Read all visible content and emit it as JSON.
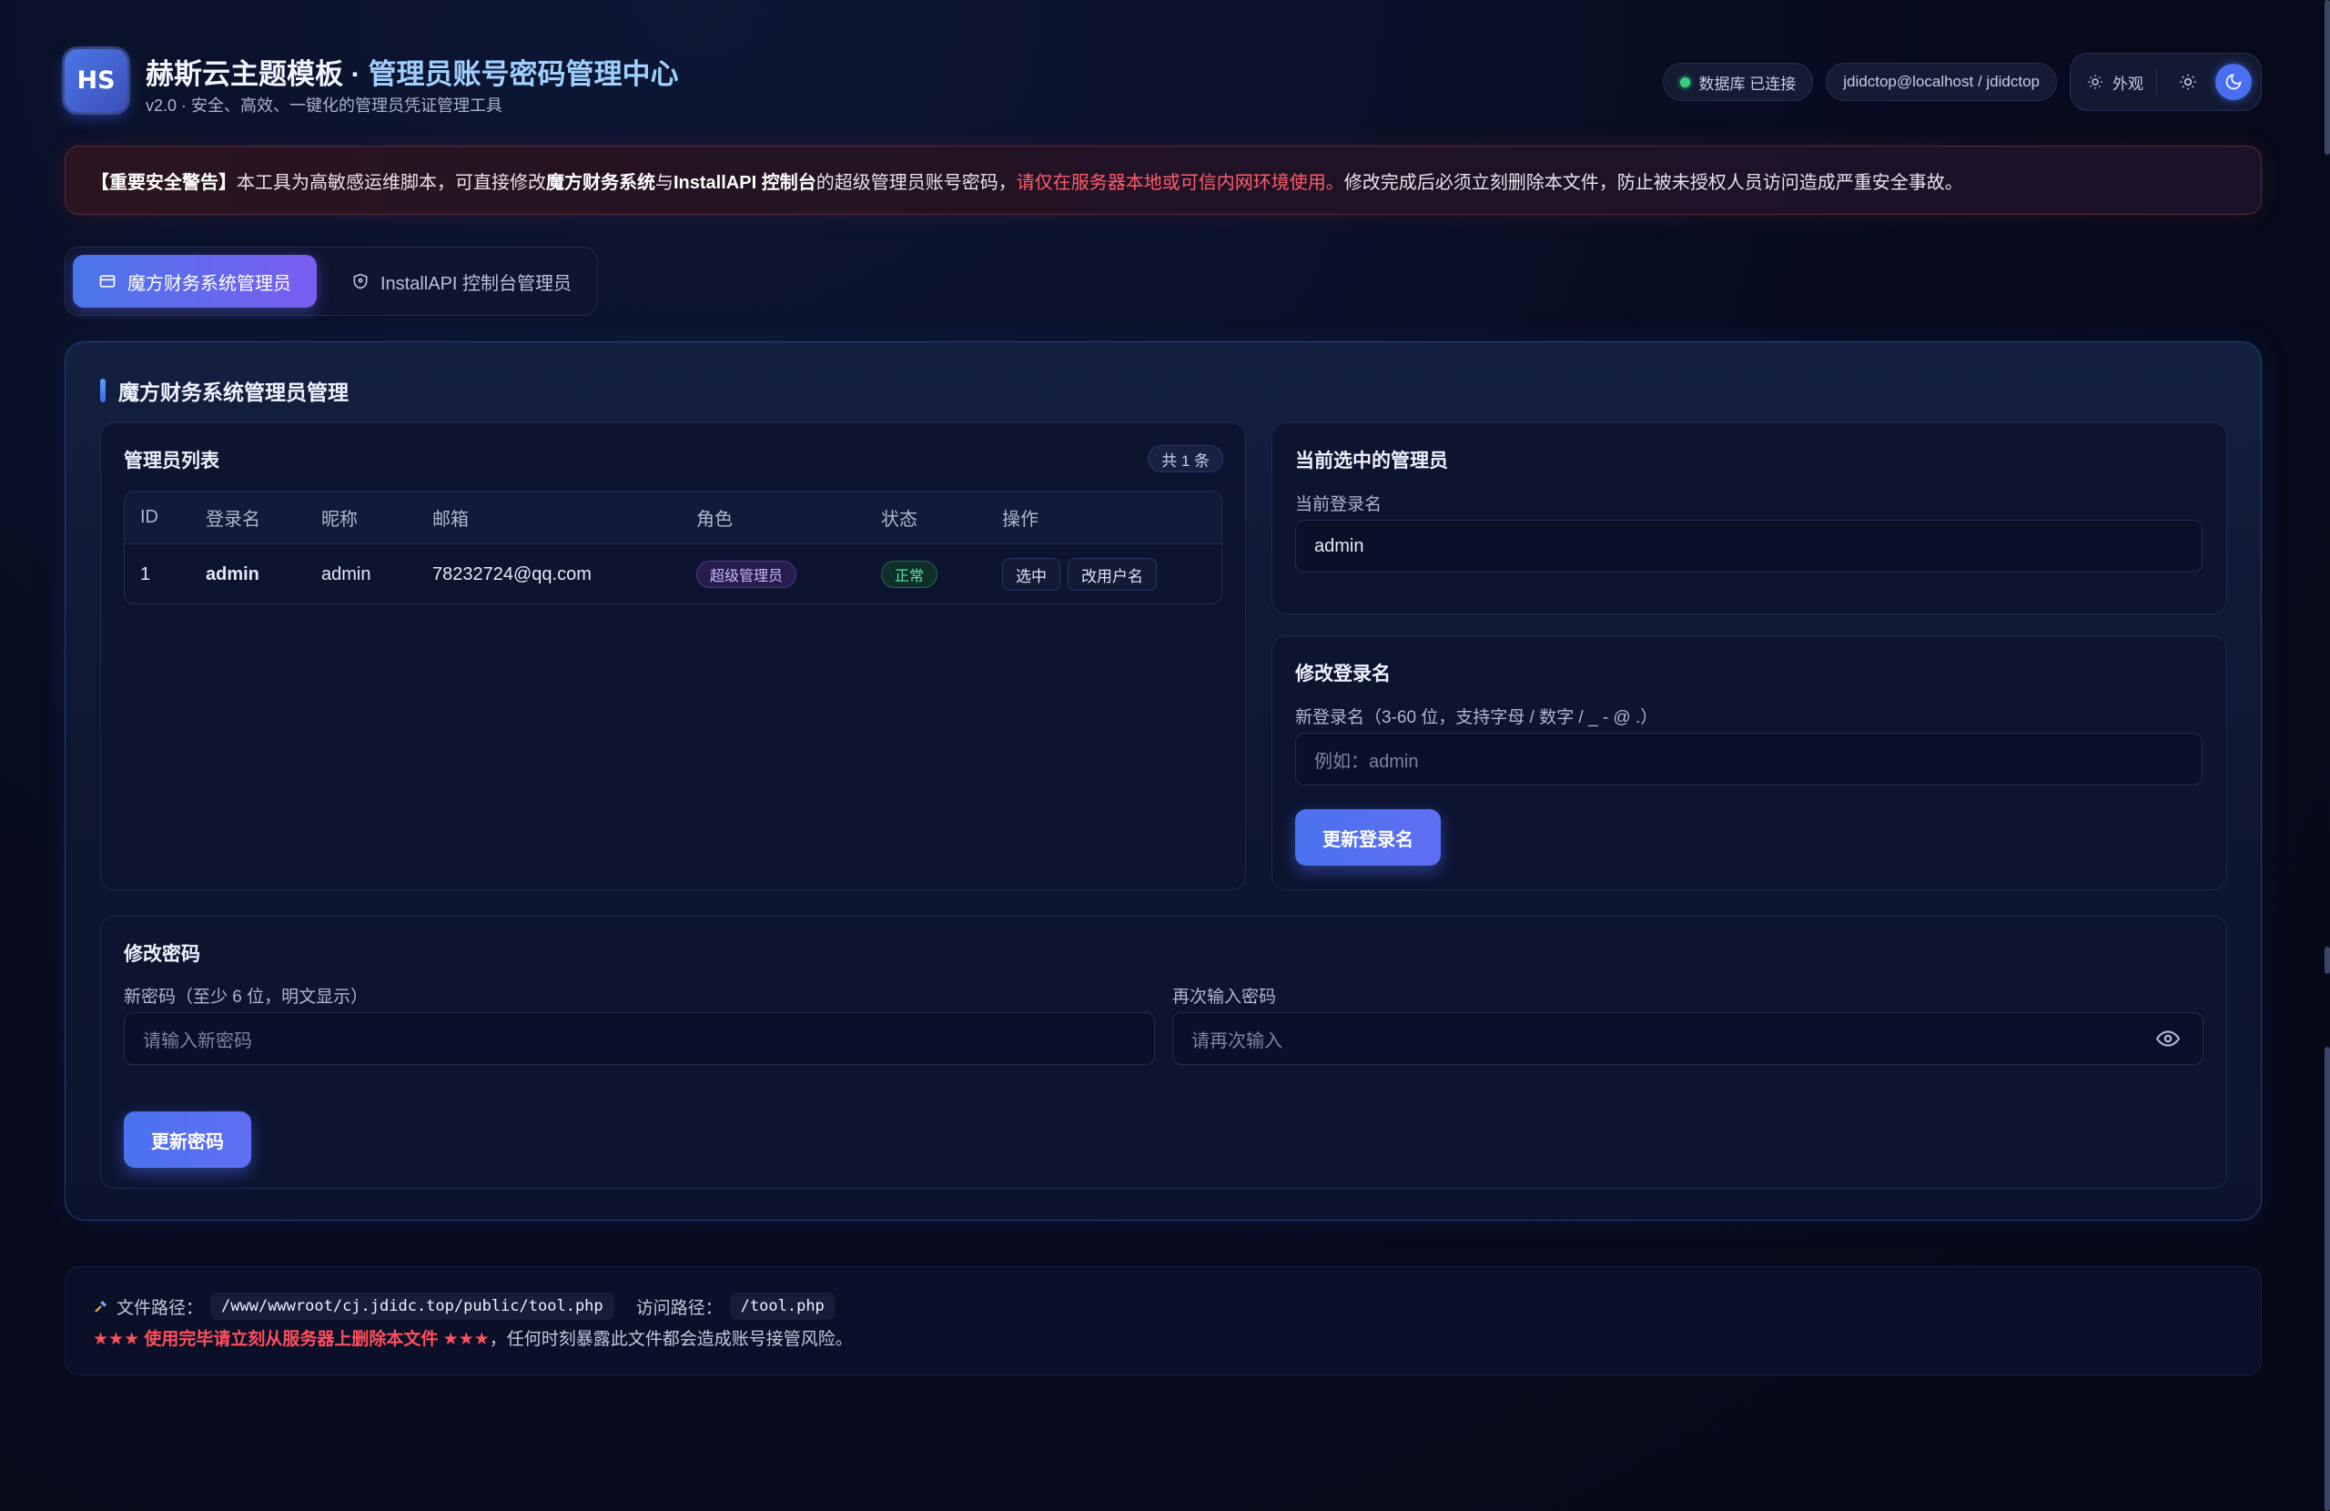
{
  "header": {
    "logo_text": "HS",
    "title_main": "赫斯云主题模板 · ",
    "title_accent": "管理员账号密码管理中心",
    "subtitle": "v2.0 · 安全、高效、一键化的管理员凭证管理工具",
    "db_status": "数据库 已连接",
    "db_user": "jdidctop@localhost / jdidctop",
    "appearance_label": "外观"
  },
  "warning": {
    "prefix": "【重要安全警告】",
    "text1": "本工具为高敏感运维脚本，可直接修改 ",
    "sys1": "魔方财务系统",
    "text2": " 与 ",
    "sys2": "InstallAPI 控制台",
    "text3": " 的超级管理员账号密码，",
    "red": "请仅在服务器本地或可信内网环境使用。",
    "text4": " 修改完成后必须立刻删除本文件，防止被未授权人员访问造成严重安全事故。"
  },
  "tabs": [
    {
      "label": "魔方财务系统管理员"
    },
    {
      "label": "InstallAPI 控制台管理员"
    }
  ],
  "panel": {
    "title": "魔方财务系统管理员管理",
    "list": {
      "title": "管理员列表",
      "count": "共 1 条",
      "columns": [
        "ID",
        "登录名",
        "昵称",
        "邮箱",
        "角色",
        "状态",
        "操作"
      ],
      "rows": [
        {
          "id": "1",
          "login": "admin",
          "nickname": "admin",
          "email": "78232724@qq.com",
          "role": "超级管理员",
          "status": "正常",
          "action_select": "选中",
          "action_rename": "改用户名"
        }
      ]
    },
    "selected": {
      "title": "当前选中的管理员",
      "label": "当前登录名",
      "value": "admin"
    },
    "rename": {
      "title": "修改登录名",
      "label": "新登录名（3-60 位，支持字母 / 数字 / _ - @ .）",
      "placeholder": "例如：admin",
      "button": "更新登录名"
    },
    "password": {
      "title": "修改密码",
      "new_label": "新密码（至少 6 位，明文显示）",
      "new_placeholder": "请输入新密码",
      "confirm_label": "再次输入密码",
      "confirm_placeholder": "请再次输入",
      "button": "更新密码"
    }
  },
  "footer": {
    "file_path_label": "文件路径：",
    "file_path": "/www/wwwroot/cj.jdidc.top/public/tool.php",
    "access_label": "访问路径：",
    "access_path": "/tool.php",
    "warn_red": "★★★ 使用完毕请立刻从服务器上删除本文件 ★★★",
    "warn_text": "，任何时刻暴露此文件都会造成账号接管风险。"
  },
  "colors": {
    "accent": "#4a76ea",
    "danger": "#ff5c6c",
    "success": "#35d07f"
  }
}
